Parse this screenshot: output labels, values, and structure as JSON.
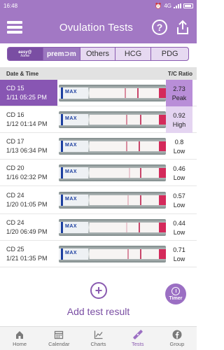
{
  "status_bar": {
    "time": "16:48",
    "network": "4G"
  },
  "header": {
    "title": "Ovulation Tests"
  },
  "tabs": [
    {
      "label_top": "easy@",
      "label_bottom": "home"
    },
    {
      "label": "prem⊃m"
    },
    {
      "label": "Others"
    },
    {
      "label": "HCG"
    },
    {
      "label": "PDG"
    }
  ],
  "columns": {
    "left": "Date & Time",
    "right": "T/C Ratio"
  },
  "tests": [
    {
      "cd": "CD 15",
      "datetime": "1/11  05:25 PM",
      "ratio": "2.73",
      "level": "Peak",
      "selected": true
    },
    {
      "cd": "CD 16",
      "datetime": "1/12  01:14 PM",
      "ratio": "0.92",
      "level": "High"
    },
    {
      "cd": "CD 17",
      "datetime": "1/13  06:34 PM",
      "ratio": "0.8",
      "level": "Low"
    },
    {
      "cd": "CD 20",
      "datetime": "1/16  02:32 PM",
      "ratio": "0.46",
      "level": "Low"
    },
    {
      "cd": "CD 24",
      "datetime": "1/20  01:05 PM",
      "ratio": "0.57",
      "level": "Low"
    },
    {
      "cd": "CD 24",
      "datetime": "1/20  06:49 PM",
      "ratio": "0.44",
      "level": "Low"
    },
    {
      "cd": "CD 25",
      "datetime": "1/21  01:35 PM",
      "ratio": "0.71",
      "level": "Low"
    }
  ],
  "strip_text": "MAX",
  "add_label": "Add test result",
  "timer_label": "Timer",
  "nav": [
    {
      "label": "Home",
      "icon": "home-icon"
    },
    {
      "label": "Calendar",
      "icon": "calendar-icon"
    },
    {
      "label": "Charts",
      "icon": "chart-icon"
    },
    {
      "label": "Tests",
      "icon": "test-strip-icon",
      "active": true
    },
    {
      "label": "Group",
      "icon": "facebook-icon"
    }
  ],
  "colors": {
    "accent": "#a278c4",
    "selected": "#8856b3",
    "peak": "#b98ed8",
    "high": "#e4d4f1"
  }
}
